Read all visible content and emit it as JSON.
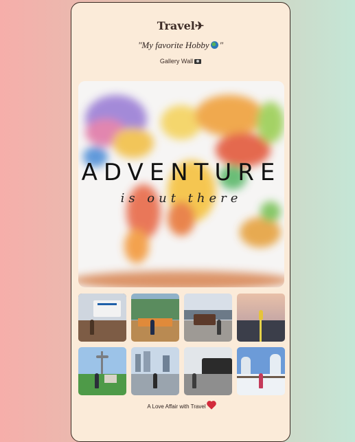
{
  "header": {
    "title": "Travel✈",
    "subtitle_text": "\"My favorite Hobby",
    "subtitle_end": "\"",
    "gallery_label": "Gallery Wall",
    "globe_icon": "globe-icon",
    "camera_icon": "camera-icon"
  },
  "hero": {
    "headline": "ADVENTURE",
    "script": "is out there"
  },
  "thumbnails": [
    {
      "label": "niagara-photo"
    },
    {
      "label": "garden-photo"
    },
    {
      "label": "yellowstone-sign-photo"
    },
    {
      "label": "sunset-road-photo"
    },
    {
      "label": "space-needle-photo"
    },
    {
      "label": "city-harbor-photo"
    },
    {
      "label": "steam-train-photo"
    },
    {
      "label": "snowy-park-photo"
    }
  ],
  "footer": {
    "text": "A Love Affair with Travel",
    "heart_icon": "heart-icon"
  },
  "colors": {
    "card_bg": "#fbebd9",
    "bg_left": "#f6aeaa",
    "bg_right": "#c4e6d6"
  }
}
